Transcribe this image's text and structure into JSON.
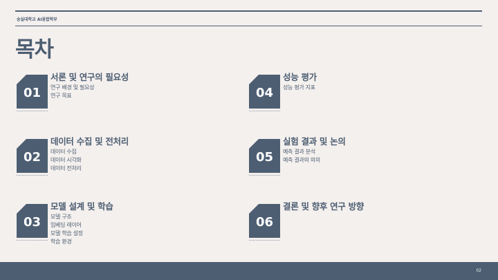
{
  "header": {
    "university": "숭실대학교 AI융합학부",
    "title": "목차"
  },
  "items": [
    {
      "num": "01",
      "title": "서론 및 연구의 필요성",
      "subs": [
        "연구 배경 및 필요성",
        "연구 목표"
      ]
    },
    {
      "num": "04",
      "title": "성능 평가",
      "subs": [
        "성능 평가 지표"
      ]
    },
    {
      "num": "02",
      "title": "데이터 수집 및 전처리",
      "subs": [
        "데이터 수집",
        "데이터 시각화",
        "데이터 전처리"
      ]
    },
    {
      "num": "05",
      "title": "실험 결과 및 논의",
      "subs": [
        "예측 결과 분석",
        "예측 결과의 의의"
      ]
    },
    {
      "num": "03",
      "title": "모델 설계 및 학습",
      "subs": [
        "모델 구조",
        "임베딩 레이어",
        "모델 학습 설정",
        "학습 환경"
      ]
    },
    {
      "num": "06",
      "title": "결론 및 향후 연구 방향",
      "subs": []
    }
  ],
  "footer": {
    "page": "02"
  },
  "colors": {
    "accent": "#4d5e72",
    "background": "#f4f0ee"
  }
}
